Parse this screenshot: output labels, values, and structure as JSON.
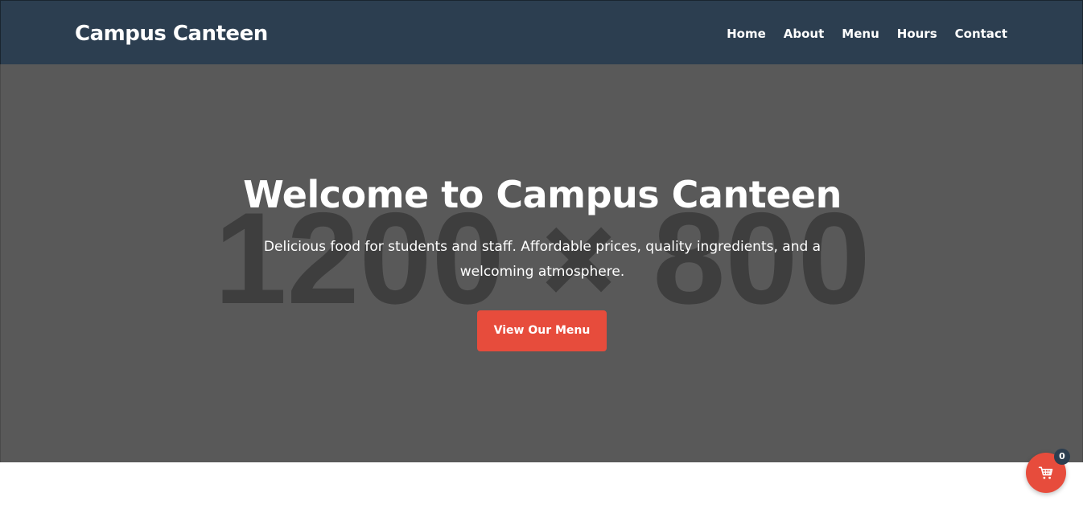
{
  "header": {
    "brand": "Campus Canteen",
    "nav": [
      {
        "label": "Home"
      },
      {
        "label": "About"
      },
      {
        "label": "Menu"
      },
      {
        "label": "Hours"
      },
      {
        "label": "Contact"
      }
    ]
  },
  "hero": {
    "placeholder": "1200 × 800",
    "title": "Welcome to Campus Canteen",
    "subtitle": "Delicious food for students and staff. Affordable prices, quality ingredients, and a welcoming atmosphere.",
    "cta_label": "View Our Menu"
  },
  "cart": {
    "icon": "cart-icon",
    "count": "0"
  },
  "colors": {
    "header_bg": "#2c3e50",
    "hero_bg": "#595959",
    "accent": "#e74c3c",
    "text_light": "#ffffff"
  }
}
